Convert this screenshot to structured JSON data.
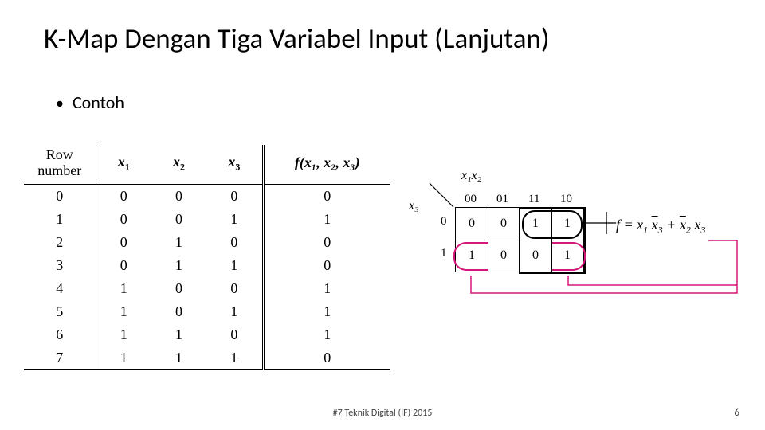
{
  "title": "K-Map Dengan Tiga Variabel Input (Lanjutan)",
  "bullet": "Contoh",
  "truth": {
    "head": {
      "rownum": "Row\nnumber",
      "x1": "x",
      "x1s": "1",
      "x2": "x",
      "x2s": "2",
      "x3": "x",
      "x3s": "3",
      "f": "f(x₁, x₂, x₃)"
    },
    "rows": [
      {
        "n": "0",
        "x1": "0",
        "x2": "0",
        "x3": "0",
        "f": "0"
      },
      {
        "n": "1",
        "x1": "0",
        "x2": "0",
        "x3": "1",
        "f": "1"
      },
      {
        "n": "2",
        "x1": "0",
        "x2": "1",
        "x3": "0",
        "f": "0"
      },
      {
        "n": "3",
        "x1": "0",
        "x2": "1",
        "x3": "1",
        "f": "0"
      },
      {
        "n": "4",
        "x1": "1",
        "x2": "0",
        "x3": "0",
        "f": "1"
      },
      {
        "n": "5",
        "x1": "1",
        "x2": "0",
        "x3": "1",
        "f": "1"
      },
      {
        "n": "6",
        "x1": "1",
        "x2": "1",
        "x3": "0",
        "f": "1"
      },
      {
        "n": "7",
        "x1": "1",
        "x2": "1",
        "x3": "1",
        "f": "0"
      }
    ]
  },
  "kmap": {
    "col_var": "x₁x₂",
    "row_var": "x₃",
    "cols": [
      "00",
      "01",
      "11",
      "10"
    ],
    "rows": [
      "0",
      "1"
    ],
    "cells": {
      "r0c0": "0",
      "r0c1": "0",
      "r0c2": "1",
      "r0c3": "1",
      "r1c0": "1",
      "r1c1": "0",
      "r1c2": "0",
      "r1c3": "1"
    },
    "eqn_prefix": "f  =  ",
    "eqn_t1a": "x",
    "eqn_t1as": "1",
    "eqn_t1b": "x",
    "eqn_t1bs": "3",
    "eqn_plus": " + ",
    "eqn_t2a": "x",
    "eqn_t2as": "2",
    "eqn_t2b": "x",
    "eqn_t2bs": "3"
  },
  "footer": {
    "center": "#7 Teknik Digital (IF) 2015",
    "page": "6"
  }
}
